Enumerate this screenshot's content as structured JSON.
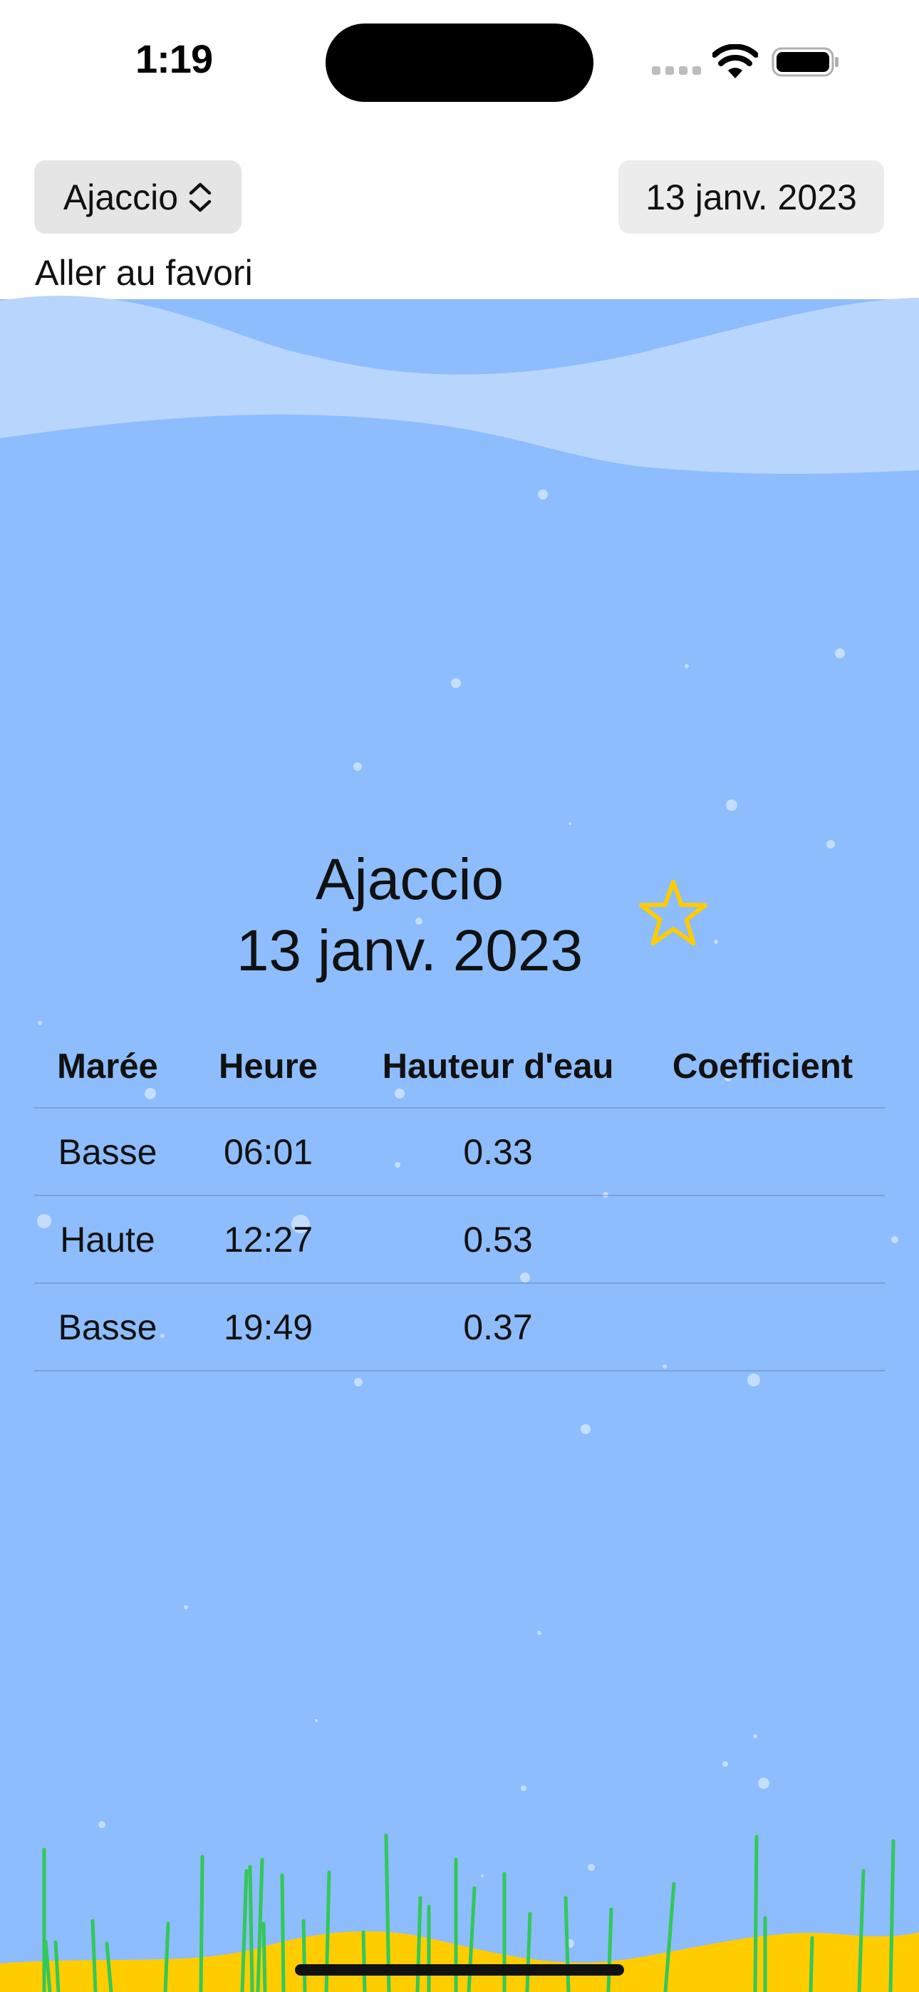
{
  "status_bar": {
    "time": "1:19"
  },
  "controls": {
    "city_picker_label": "Ajaccio",
    "date_picker_label": "13 janv. 2023",
    "favorite_link": "Aller au favori"
  },
  "header": {
    "city": "Ajaccio",
    "date": "13 janv. 2023",
    "favorite_icon": "star-outline-icon"
  },
  "table": {
    "columns": [
      "Marée",
      "Heure",
      "Hauteur d'eau",
      "Coefficient"
    ],
    "rows": [
      [
        "Basse",
        "06:01",
        "0.33",
        ""
      ],
      [
        "Haute",
        "12:27",
        "0.53",
        ""
      ],
      [
        "Basse",
        "19:49",
        "0.37",
        ""
      ]
    ]
  },
  "colors": {
    "sky": "#ffffff",
    "wave_light": "#b8d5fd",
    "water": "#8dbdfd",
    "sand": "#ffcc00",
    "seaweed": "#34c759",
    "star": "#ffcc00"
  }
}
